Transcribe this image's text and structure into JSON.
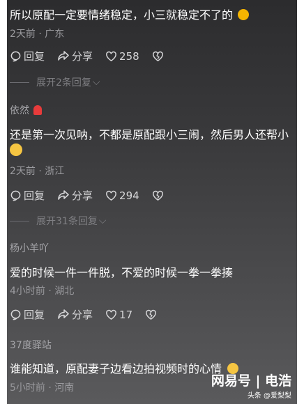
{
  "comments": [
    {
      "text": "所以原配一定要情绪稳定，小三就稳定不了的",
      "meta": "2天前 · 广东",
      "reply": "回复",
      "share": "分享",
      "likes": "258",
      "expand": "展开2条回复"
    },
    {
      "author": "依然",
      "text_line1": "还是第一次见呐，不都是原配跟小三闹，然后男人还帮小",
      "meta": "2天前 · 浙江",
      "reply": "回复",
      "share": "分享",
      "likes": "294",
      "expand": "展开31条回复"
    },
    {
      "author": "杨小羊吖",
      "text": "爱的时候一件一件脱，不爱的时候一拳一拳揍",
      "meta": "4小时前 · 湖北",
      "reply": "回复",
      "share": "分享",
      "likes": "17"
    },
    {
      "author": "37度驿站",
      "text": "谁能知道，原配妻子边看边拍视频时的心情",
      "meta": "5小时前 · 河南"
    }
  ],
  "watermark": {
    "brand": "网易号 | 电浩",
    "sub": "头条 @爱梨梨"
  },
  "colors": {
    "background_top": "#2c2c2e",
    "background_bottom": "#5a5a5c",
    "text": "#ffffff",
    "meta": "#9a9a9e"
  }
}
